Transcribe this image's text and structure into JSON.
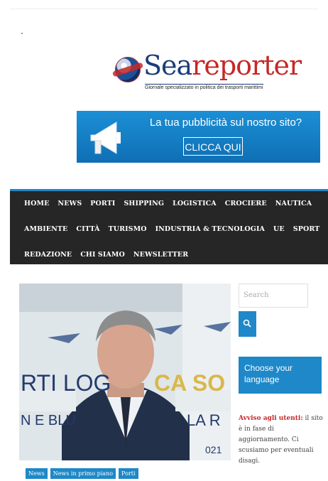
{
  "logo": {
    "name_part1": "Sea",
    "name_part2": "reporter",
    "tagline": "Giornale specializzato in politica dei trasporti marittimi"
  },
  "banner": {
    "text": "La tua pubblicità sul nostro sito?",
    "button": "CLICCA QUI",
    "icon": "megaphone-icon"
  },
  "nav": {
    "row1": [
      "HOME",
      "NEWS",
      "PORTI",
      "SHIPPING",
      "LOGISTICA",
      "CROCIERE",
      "NAUTICA"
    ],
    "row2": [
      "AMBIENTE",
      "CITTÀ",
      "TURISMO",
      "INDUSTRIA & TECNOLOGIA",
      "UE",
      "SPORT"
    ],
    "row3": [
      "REDAZIONE",
      "CHI SIAMO",
      "NEWSLETTER"
    ]
  },
  "article": {
    "image_text_1": "RTI LOG",
    "image_text_2": "CA SO",
    "image_text_3": "N E BLU",
    "image_text_4": "LA R",
    "image_text_5": "021",
    "tags": [
      "News",
      "News in primo piano",
      "Porti"
    ]
  },
  "sidebar": {
    "search_placeholder": "Search",
    "language_box": "Choose your language",
    "notice_label": "Avviso agli utenti:",
    "notice_text": " il sito è in fase di aggiornamento. Ci scusiamo per eventuali disagi."
  },
  "colors": {
    "accent": "#1e88c8",
    "nav_bg": "#262626",
    "logo_blue": "#1a3d7a",
    "logo_red": "#c62828"
  }
}
